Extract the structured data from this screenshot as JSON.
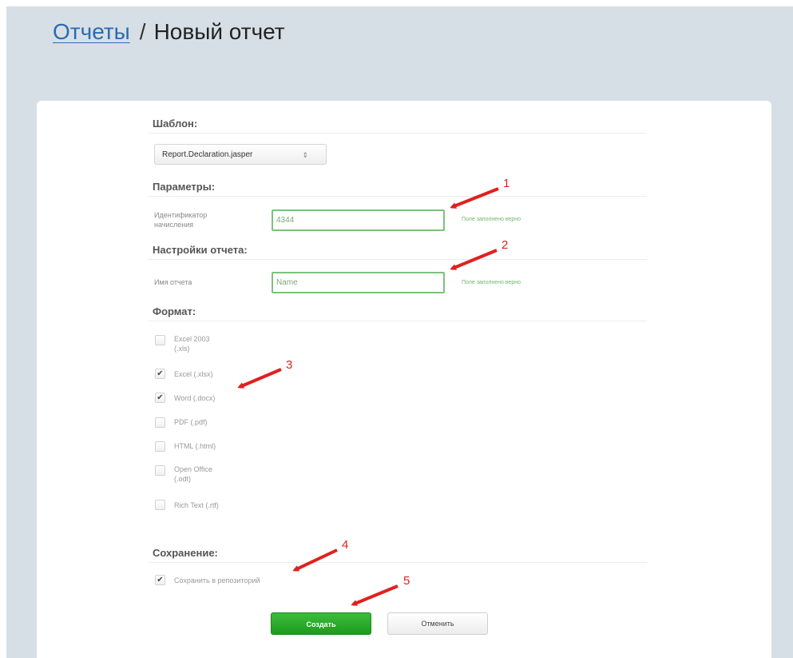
{
  "breadcrumb": {
    "parent": "Отчеты",
    "separator": "/",
    "current": "Новый отчет"
  },
  "template": {
    "section_title": "Шаблон:",
    "selected": "Report.Declaration.jasper",
    "arrows_glyph": "⇕"
  },
  "parameters": {
    "section_title": "Параметры:",
    "field_label": "Идентификатор начисления",
    "field_value": "4344",
    "valid_message": "Поле заполнено верно"
  },
  "report_settings": {
    "section_title": "Настройки отчета:",
    "field_label": "Имя отчета",
    "field_value": "Name",
    "valid_message": "Поле заполнено верно"
  },
  "format": {
    "section_title": "Формат:",
    "options": [
      {
        "label": "Excel 2003 (.xls)",
        "checked": false
      },
      {
        "label": "Excel (.xlsx)",
        "checked": true
      },
      {
        "label": "Word (.docx)",
        "checked": true
      },
      {
        "label": "PDF (.pdf)",
        "checked": false
      },
      {
        "label": "HTML (.html)",
        "checked": false
      },
      {
        "label": "Open Office (.odt)",
        "checked": false
      },
      {
        "label": "Rich Text (.rtf)",
        "checked": false
      }
    ]
  },
  "saving": {
    "section_title": "Сохранение:",
    "option_label": "Сохранить в репозиторий",
    "checked": true
  },
  "buttons": {
    "create": "Создать",
    "cancel": "Отменить"
  },
  "check_glyph": "✔",
  "annotations": {
    "color": "#e02020",
    "numbers": [
      "1",
      "2",
      "3",
      "4",
      "5"
    ]
  }
}
